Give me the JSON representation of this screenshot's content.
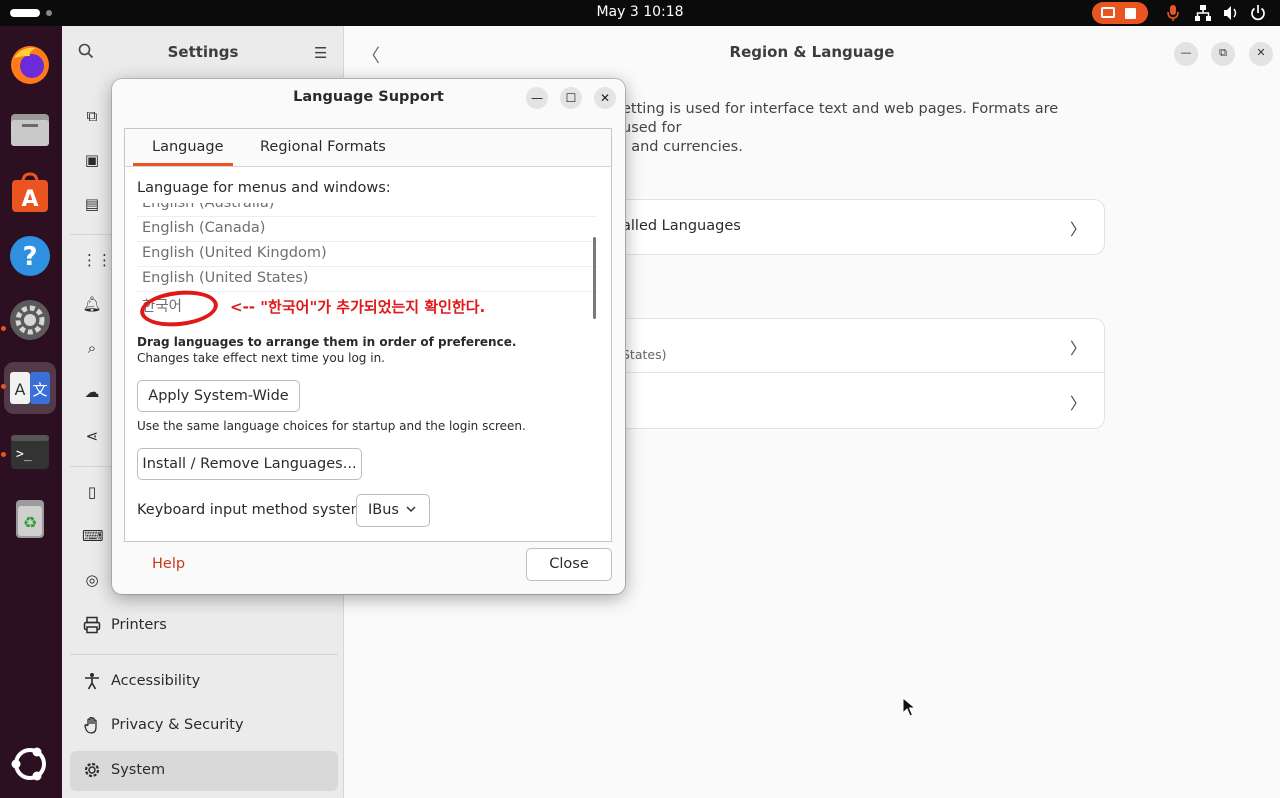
{
  "topbar": {
    "clock": "May 3  10:18"
  },
  "dock": {
    "apps": [
      "firefox-icon",
      "files-icon",
      "app-center-icon",
      "help-icon",
      "settings-icon",
      "language-icon",
      "terminal-icon",
      "trash-icon",
      "ubuntu-icon"
    ],
    "language_glyph_a": "A",
    "language_glyph_b": "文",
    "terminal_glyph": ">_"
  },
  "settings": {
    "title": "Settings",
    "sidebar_items": [
      {
        "label": "Printers"
      },
      {
        "label": "Accessibility"
      },
      {
        "label": "Privacy & Security"
      },
      {
        "label": "System"
      }
    ]
  },
  "main": {
    "title": "Region & Language",
    "description": "etting is used for interface text and web pages. Formats are used for\n, and currencies.",
    "rows": {
      "installed_languages": "alled Languages",
      "formats_sub": "States)"
    }
  },
  "dialog": {
    "title": "Language Support",
    "tabs": [
      "Language",
      "Regional Formats"
    ],
    "language_label": "Language for menus and windows:",
    "languages": [
      "English (Australia)",
      "English (Canada)",
      "English (United Kingdom)",
      "English (United States)",
      "한국어"
    ],
    "annotation": "<-- \"한국어\"가 추가되었는지 확인한다.",
    "drag_note": "Drag languages to arrange them in order of preference.",
    "drag_sub": "Changes take effect next time you log in.",
    "apply_button": "Apply System-Wide",
    "apply_note": "Use the same language choices for startup and the login screen.",
    "install_button": "Install / Remove Languages...",
    "keyboard_label": "Keyboard input method system:",
    "keyboard_value": "IBus",
    "help": "Help",
    "close": "Close"
  },
  "colors": {
    "accent": "#e95420",
    "annotation": "#e01818",
    "dock_bg": "#2c0f21"
  }
}
